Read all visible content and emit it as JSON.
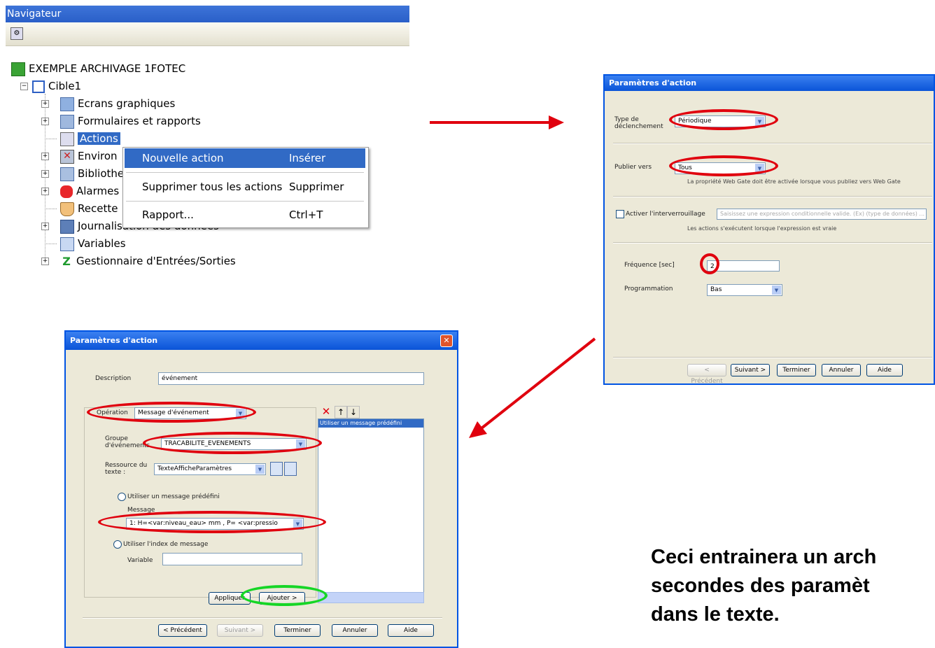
{
  "navigator": {
    "title": "Navigateur",
    "root": "EXEMPLE ARCHIVAGE 1FOTEC",
    "target": "Cible1",
    "items": [
      "Ecrans graphiques",
      "Formulaires et rapports",
      "Actions",
      "Environ",
      "Bibliothe",
      "Alarmes",
      "Recette",
      "Journalisation des données",
      "Variables",
      "Gestionnaire d'Entrées/Sorties"
    ]
  },
  "context_menu": {
    "items": [
      {
        "label": "Nouvelle action",
        "shortcut": "Insérer"
      },
      {
        "label": "Supprimer tous les actions",
        "shortcut": "Supprimer"
      },
      {
        "label": "Rapport...",
        "shortcut": "Ctrl+T"
      }
    ]
  },
  "dialog_right": {
    "title": "Paramètres d'action",
    "trigger_label": "Type de déclenchement",
    "trigger_value": "Périodique",
    "publish_label": "Publier vers",
    "publish_value": "Tous",
    "publish_note": "La propriété Web Gate doit être activée lorsque vous publiez vers Web Gate",
    "interlock_label": "Activer l'interverrouillage",
    "interlock_field": "Saisissez une expression conditionnelle valide. (Ex) (type de données) ...",
    "interlock_note": "Les actions s'exécutent lorsque l'expression est vraie",
    "freq_label": "Fréquence [sec]",
    "freq_value": "2",
    "prog_label": "Programmation",
    "prog_value": "Bas",
    "buttons": [
      "< Précédent",
      "Suivant >",
      "Terminer",
      "Annuler",
      "Aide"
    ]
  },
  "dialog_left": {
    "title": "Paramètres d'action",
    "description_label": "Description",
    "description_value": "événement",
    "operation_label": "Opération",
    "operation_value": "Message d'événement",
    "group_label": "Groupe d'événements",
    "group_value": "TRACABILITE_EVENEMENTS",
    "resource_label": "Ressource du texte :",
    "resource_value": "TexteAfficheParamètres",
    "use_predefined": "Utiliser un message prédéfini",
    "message_label": "Message",
    "message_value": "1: H=<var:niveau_eau> mm , P= <var:pressio",
    "use_index": "Utiliser l'index de message",
    "variable_label": "Variable",
    "list_header": "Utiliser un message prédéfini",
    "apply": "Appliquer",
    "add": "Ajouter >",
    "buttons": [
      "< Précédent",
      "Suivant >",
      "Terminer",
      "Annuler",
      "Aide"
    ]
  },
  "caption": {
    "line1": "Ceci entrainera un arch",
    "line2": "secondes des paramèt",
    "line3": "dans le texte."
  },
  "colors": {
    "highlight_ellipse": "#e0000e",
    "green_ellipse": "#16d626",
    "arrow": "#e0000e",
    "title_bar": "#0a54d8"
  }
}
